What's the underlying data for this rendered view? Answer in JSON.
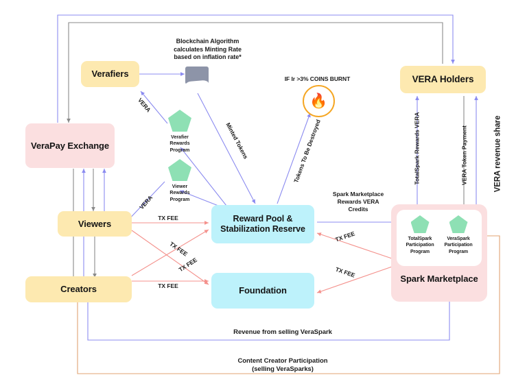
{
  "diagram": {
    "title": "VERA token economy flow diagram",
    "colors": {
      "yellow": "#fde9b0",
      "pink": "#fbdfe0",
      "cyan": "#bdf2fb",
      "green_pentagon": "#8ee0b4",
      "purple_edge": "#8b8bf0",
      "gray_edge": "#8a8a8a",
      "red_edge": "#f4918c",
      "orange_edge": "#e0a372",
      "flag_gray": "#8d94a8",
      "fire_orange": "#f5a623"
    }
  },
  "nodes": {
    "verafiers": "Verafiers",
    "verapay_exchange": "VeraPay\nExchange",
    "viewers": "Viewers",
    "creators": "Creators",
    "reward_pool": "Reward Pool &\nStabilization Reserve",
    "foundation": "Foundation",
    "vera_holders": "VERA Holders",
    "spark_marketplace": "Spark Marketplace"
  },
  "programs": {
    "verafier_rewards": "Verafier\nRewards\nProgram",
    "viewer_rewards": "Viewer\nRewards\nProgram",
    "totalspark_participation": "TotalSpark\nParticipation\nProgram",
    "veraspark_participation": "VeraSpark\nParticipation\nProgram"
  },
  "annotations": {
    "blockchain_algorithm": "Blockchain Algorithm\ncalculates Minting Rate\nbased on inflation rate*",
    "coins_burnt": "IF Ir >3% COINS BURNT",
    "minted_tokens": "Minted Tokens",
    "tokens_destroyed": "Tokens To Be Destroyed",
    "vera_verafier": "VERA",
    "vera_viewer": "VERA",
    "tx_fee_1": "TX FEE",
    "tx_fee_2": "TX FEE",
    "tx_fee_3": "TX FEE",
    "tx_fee_4": "TX FEE",
    "tx_fee_5": "TX FEE",
    "tx_fee_6": "TX FEE",
    "spark_marketplace_rewards": "Spark Marketplace\nRewards VERA\nCredits",
    "totalspark_rewards_vera": "TotalSpark Rewards VERA",
    "vera_token_payment": "VERA  Token Payment",
    "vera_revenue_share": "VERA revenue share",
    "revenue_from_veraspark": "Revenue from selling VeraSpark",
    "content_creator_participation": "Content Creator Participation\n(selling VeraSparks)"
  },
  "icons": {
    "blockchain_flag": "flag-icon",
    "burn": "fire-icon"
  }
}
